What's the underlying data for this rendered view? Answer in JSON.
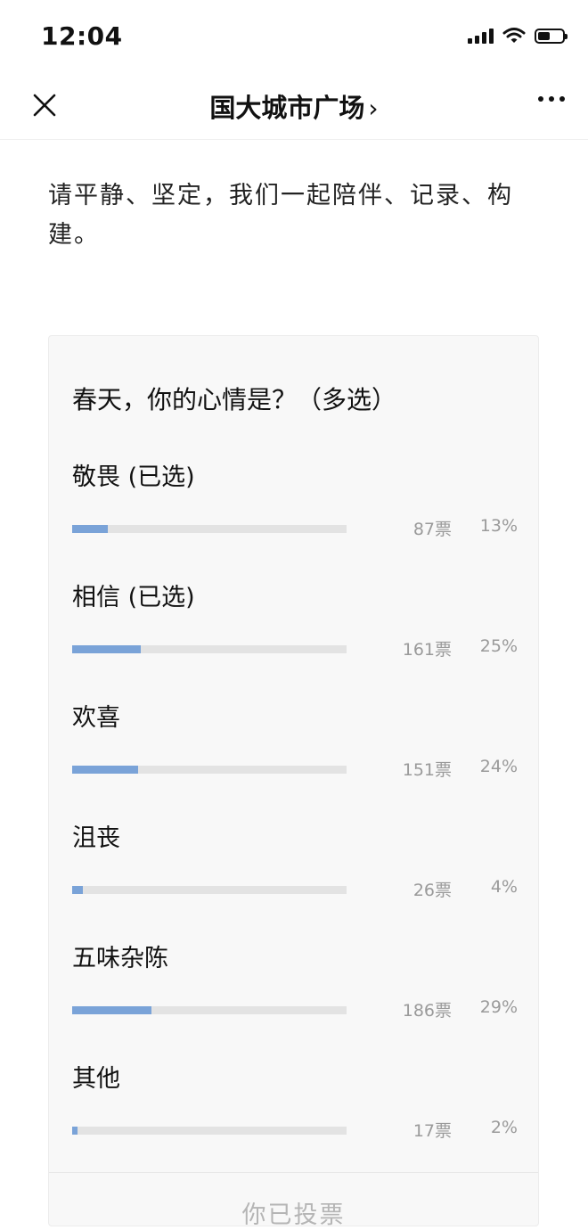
{
  "status_bar": {
    "time": "12:04"
  },
  "nav": {
    "title": "国大城市广场",
    "chevron": "›"
  },
  "intro_text": "请平静、坚定，我们一起陪伴、记录、构建。",
  "poll": {
    "question": "春天，你的心情是？（多选）",
    "accent_color": "#7aa3d8",
    "options": [
      {
        "label": "敬畏 (已选)",
        "votes": "87票",
        "percent": "13%",
        "fraction": 0.13
      },
      {
        "label": "相信 (已选)",
        "votes": "161票",
        "percent": "25%",
        "fraction": 0.25
      },
      {
        "label": "欢喜",
        "votes": "151票",
        "percent": "24%",
        "fraction": 0.24
      },
      {
        "label": "沮丧",
        "votes": "26票",
        "percent": "4%",
        "fraction": 0.04
      },
      {
        "label": "五味杂陈",
        "votes": "186票",
        "percent": "29%",
        "fraction": 0.29
      },
      {
        "label": "其他",
        "votes": "17票",
        "percent": "2%",
        "fraction": 0.02
      }
    ],
    "voted_label": "你已投票"
  },
  "icons": {
    "close": "close-icon",
    "more": "more-icon",
    "signal": "signal-icon",
    "wifi": "wifi-icon",
    "battery": "battery-icon"
  }
}
